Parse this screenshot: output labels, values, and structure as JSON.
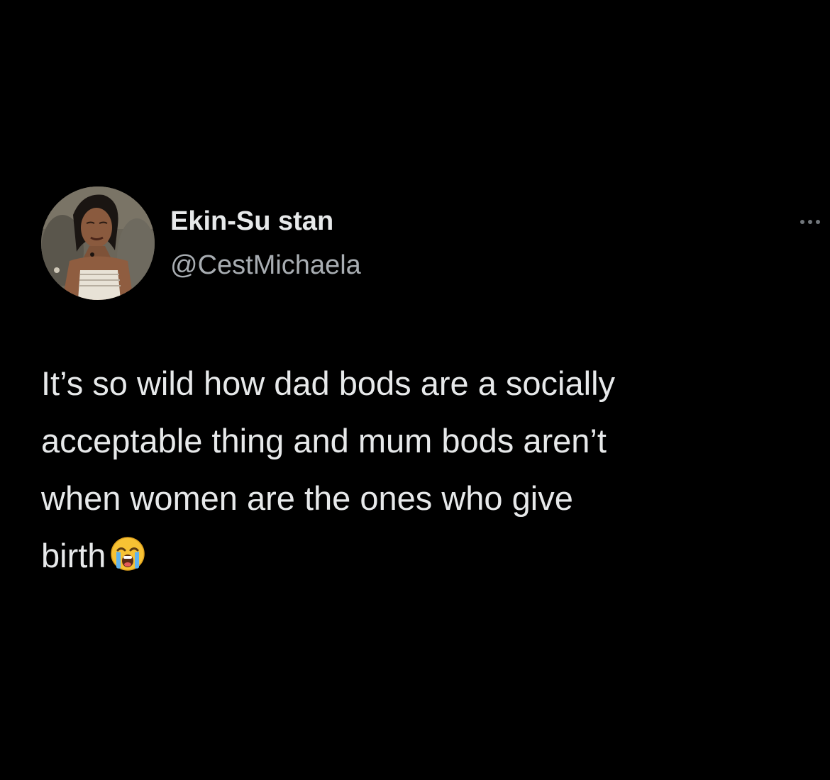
{
  "tweet": {
    "author": {
      "display_name": "Ekin-Su stan",
      "handle": "@CestMichaela",
      "avatar_icon": "profile-photo"
    },
    "more_icon": "ellipsis-icon",
    "text_lines": [
      "It’s so wild how dad bods are a socially",
      "acceptable thing and mum bods aren’t",
      "when women are the ones who give",
      "birth"
    ],
    "emoji": "loudly-crying-face",
    "colors": {
      "background": "#000000",
      "text": "#e7e9ea",
      "secondary_text": "#a8adb2"
    }
  }
}
